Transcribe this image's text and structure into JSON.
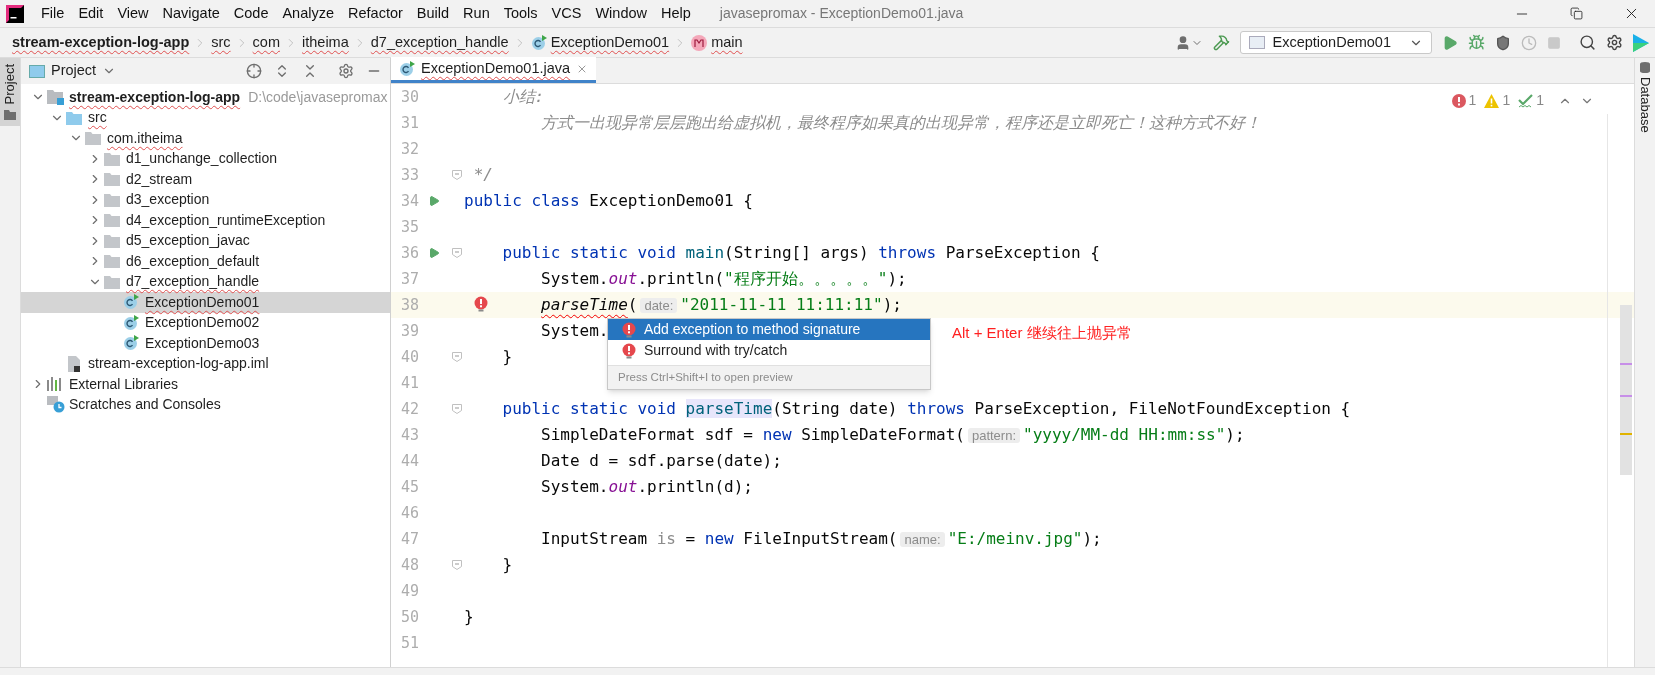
{
  "menu_bar": {
    "items": [
      "File",
      "Edit",
      "View",
      "Navigate",
      "Code",
      "Analyze",
      "Refactor",
      "Build",
      "Run",
      "Tools",
      "VCS",
      "Window",
      "Help"
    ],
    "title": "javasepromax - ExceptionDemo01.java"
  },
  "navigation_bar": {
    "breadcrumbs": [
      {
        "label": "stream-exception-log-app",
        "kind": "module",
        "typo": true
      },
      {
        "label": "src",
        "kind": "folder",
        "typo": true
      },
      {
        "label": "com",
        "kind": "folder",
        "typo": true
      },
      {
        "label": "itheima",
        "kind": "folder",
        "typo": true
      },
      {
        "label": "d7_exception_handle",
        "kind": "folder",
        "typo": true
      },
      {
        "label": "ExceptionDemo01",
        "kind": "class",
        "typo": true
      },
      {
        "label": "main",
        "kind": "method",
        "typo": true
      }
    ],
    "run_configuration": "ExceptionDemo01"
  },
  "left_strip": {
    "label": "Project"
  },
  "right_strip": {
    "label": "Database"
  },
  "project_panel": {
    "title": "Project",
    "tree": [
      {
        "label": "stream-exception-log-app",
        "kind": "module",
        "path": "D:\\code\\javasepromax",
        "expanded": true,
        "selected": false,
        "typo": true,
        "children": [
          {
            "label": "src",
            "kind": "source",
            "expanded": true,
            "selected": false,
            "typo": true,
            "children": [
              {
                "label": "com.itheima",
                "kind": "package",
                "expanded": true,
                "selected": false,
                "typo": true,
                "children": [
                  {
                    "label": "d1_unchange_collection",
                    "kind": "package",
                    "expanded": false,
                    "selected": false,
                    "typo": false
                  },
                  {
                    "label": "d2_stream",
                    "kind": "package",
                    "expanded": false,
                    "selected": false,
                    "typo": false
                  },
                  {
                    "label": "d3_exception",
                    "kind": "package",
                    "expanded": false,
                    "selected": false,
                    "typo": false
                  },
                  {
                    "label": "d4_exception_runtimeException",
                    "kind": "package",
                    "expanded": false,
                    "selected": false,
                    "typo": false
                  },
                  {
                    "label": "d5_exception_javac",
                    "kind": "package",
                    "expanded": false,
                    "selected": false,
                    "typo": false
                  },
                  {
                    "label": "d6_exception_default",
                    "kind": "package",
                    "expanded": false,
                    "selected": false,
                    "typo": false
                  },
                  {
                    "label": "d7_exception_handle",
                    "kind": "package",
                    "expanded": true,
                    "selected": false,
                    "typo": true,
                    "children": [
                      {
                        "label": "ExceptionDemo01",
                        "kind": "class",
                        "selected": true,
                        "typo": true
                      },
                      {
                        "label": "ExceptionDemo02",
                        "kind": "class",
                        "selected": false,
                        "typo": false
                      },
                      {
                        "label": "ExceptionDemo03",
                        "kind": "class",
                        "selected": false,
                        "typo": false
                      }
                    ]
                  }
                ]
              }
            ]
          },
          {
            "label": "stream-exception-log-app.iml",
            "kind": "file",
            "selected": false,
            "typo": false
          }
        ]
      },
      {
        "label": "External Libraries",
        "kind": "libraries",
        "expanded": false,
        "selected": false,
        "typo": false
      },
      {
        "label": "Scratches and Consoles",
        "kind": "scratches",
        "selected": false,
        "typo": false
      }
    ]
  },
  "editor": {
    "tabs": [
      {
        "label": "ExceptionDemo01.java",
        "selected": true,
        "typo": true
      }
    ],
    "inspections": [
      {
        "kind": "error",
        "count": "1"
      },
      {
        "kind": "warning",
        "count": "1"
      },
      {
        "kind": "typo",
        "count": "1"
      }
    ],
    "lines": [
      {
        "number": "30",
        "current": false,
        "kind": "plain",
        "tokens": [
          {
            "kind": "comment",
            "text": "    小结:"
          }
        ]
      },
      {
        "number": "31",
        "current": false,
        "kind": "plain",
        "tokens": [
          {
            "kind": "comment",
            "text": "        方式一出现异常层层跑出给虚拟机，最终程序如果真的出现异常，程序还是立即死亡！这种方式不好！"
          }
        ]
      },
      {
        "number": "32",
        "current": false,
        "kind": "plain"
      },
      {
        "number": "33",
        "current": false,
        "kind": "plain",
        "fold": true,
        "tokens": [
          {
            "kind": "comment",
            "text": " */"
          }
        ]
      },
      {
        "number": "34",
        "current": false,
        "kind": "run",
        "tokens": [
          {
            "kind": "kw",
            "text": "public class "
          },
          {
            "kind": "plain",
            "text": "ExceptionDemo01 {"
          }
        ]
      },
      {
        "number": "35",
        "current": false,
        "kind": "plain"
      },
      {
        "number": "36",
        "current": false,
        "kind": "run",
        "fold": true,
        "tokens": [
          {
            "kind": "kw",
            "text": "    public static void "
          },
          {
            "kind": "fn",
            "text": "main"
          },
          {
            "kind": "plain",
            "text": "(String[] args) "
          },
          {
            "kind": "kw",
            "text": "throws "
          },
          {
            "kind": "plain",
            "text": "ParseException {"
          }
        ]
      },
      {
        "number": "37",
        "current": false,
        "kind": "plain",
        "tokens": [
          {
            "kind": "plain",
            "text": "        System."
          },
          {
            "kind": "static",
            "text": "out"
          },
          {
            "kind": "plain",
            "text": ".println("
          },
          {
            "kind": "str",
            "text": "\"程序开始。。。。。\""
          },
          {
            "kind": "plain",
            "text": ");"
          }
        ]
      },
      {
        "number": "38",
        "current": true,
        "kind": "error",
        "tokens": [
          {
            "kind": "call-error",
            "text": "        parseTime"
          },
          {
            "kind": "plain",
            "text": "("
          },
          {
            "kind": "hint",
            "text": "date:"
          },
          {
            "kind": "str",
            "text": "\"2011-11-11 11:11:11\""
          },
          {
            "kind": "plain",
            "text": ");"
          }
        ]
      },
      {
        "number": "39",
        "current": false,
        "kind": "plain",
        "tokens": [
          {
            "kind": "plain",
            "text": "        System."
          }
        ]
      },
      {
        "number": "40",
        "current": false,
        "kind": "plain",
        "fold": true,
        "tokens": [
          {
            "kind": "plain",
            "text": "    }"
          }
        ]
      },
      {
        "number": "41",
        "current": false,
        "kind": "plain"
      },
      {
        "number": "42",
        "current": false,
        "kind": "plain",
        "fold": true,
        "tokens": [
          {
            "kind": "kw",
            "text": "    public static void "
          },
          {
            "kind": "fn-highlight",
            "text": "parseTime"
          },
          {
            "kind": "plain",
            "text": "(String date) "
          },
          {
            "kind": "kw",
            "text": "throws "
          },
          {
            "kind": "plain",
            "text": "ParseException, FileNotFoundException {"
          }
        ]
      },
      {
        "number": "43",
        "current": false,
        "kind": "plain",
        "tokens": [
          {
            "kind": "plain",
            "text": "        SimpleDateFormat sdf = "
          },
          {
            "kind": "kw",
            "text": "new "
          },
          {
            "kind": "plain",
            "text": "SimpleDateFormat("
          },
          {
            "kind": "hint",
            "text": "pattern:"
          },
          {
            "kind": "str",
            "text": "\"yyyy/MM-dd HH:mm:ss\""
          },
          {
            "kind": "plain",
            "text": ");"
          }
        ]
      },
      {
        "number": "44",
        "current": false,
        "kind": "plain",
        "tokens": [
          {
            "kind": "plain",
            "text": "        Date d = sdf.parse(date);"
          }
        ]
      },
      {
        "number": "45",
        "current": false,
        "kind": "plain",
        "tokens": [
          {
            "kind": "plain",
            "text": "        System."
          },
          {
            "kind": "static",
            "text": "out"
          },
          {
            "kind": "plain",
            "text": ".println(d);"
          }
        ]
      },
      {
        "number": "46",
        "current": false,
        "kind": "plain"
      },
      {
        "number": "47",
        "current": false,
        "kind": "plain",
        "tokens": [
          {
            "kind": "plain",
            "text": "        InputStream "
          },
          {
            "kind": "unused",
            "text": "is"
          },
          {
            "kind": "plain",
            "text": " = "
          },
          {
            "kind": "kw",
            "text": "new "
          },
          {
            "kind": "plain",
            "text": "FileInputStream("
          },
          {
            "kind": "hint",
            "text": "name:"
          },
          {
            "kind": "str",
            "text": "\"E:/meinv.jpg\""
          },
          {
            "kind": "plain",
            "text": ");"
          }
        ]
      },
      {
        "number": "48",
        "current": false,
        "kind": "plain",
        "fold": true,
        "tokens": [
          {
            "kind": "plain",
            "text": "    }"
          }
        ]
      },
      {
        "number": "49",
        "current": false,
        "kind": "plain"
      },
      {
        "number": "50",
        "current": false,
        "kind": "plain",
        "tokens": [
          {
            "kind": "plain",
            "text": "}"
          }
        ]
      },
      {
        "number": "51",
        "current": false,
        "kind": "plain"
      }
    ],
    "popup": {
      "items": [
        {
          "label": "Add exception to method signature",
          "selected": true
        },
        {
          "label": "Surround with try/catch",
          "selected": false
        }
      ],
      "footer": "Press Ctrl+Shift+I to open preview"
    },
    "annotation": "Alt + Enter 继续往上抛异常"
  }
}
